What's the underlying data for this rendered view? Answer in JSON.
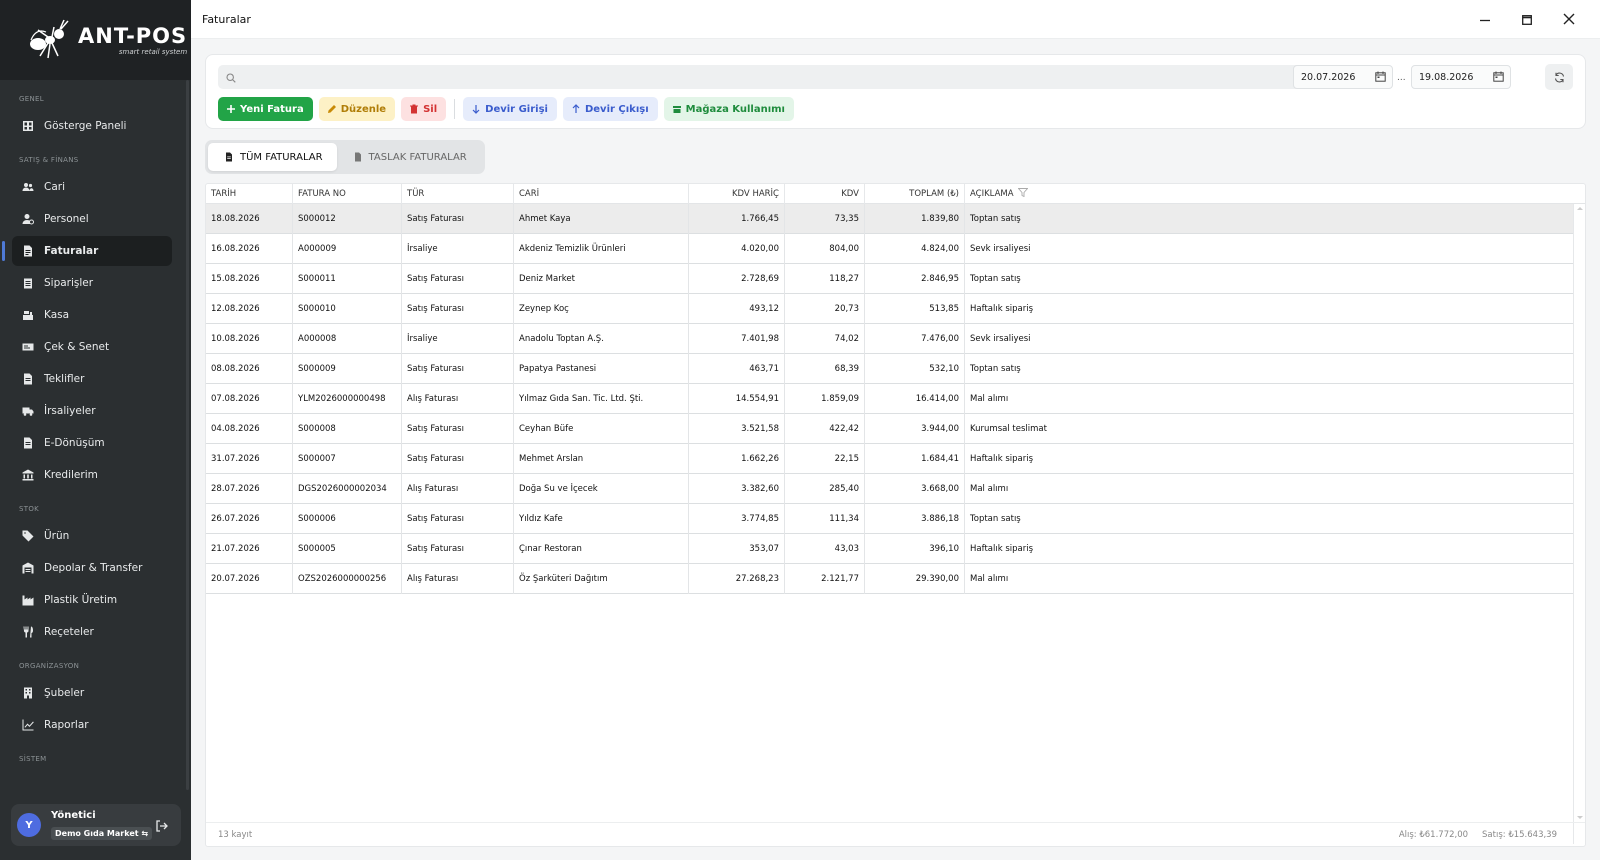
{
  "app": {
    "logo_title": "ANT-POS",
    "logo_subtitle": "smart retail system",
    "window_title": "Faturalar"
  },
  "sidebar": {
    "sections": {
      "genel": "GENEL",
      "satis": "SATIŞ & FİNANS",
      "stok": "STOK",
      "org": "ORGANİZASYON",
      "sistem": "SİSTEM"
    },
    "items": {
      "gosterge": "Gösterge Paneli",
      "cari": "Cari",
      "personel": "Personel",
      "faturalar": "Faturalar",
      "siparisler": "Siparişler",
      "kasa": "Kasa",
      "cek": "Çek & Senet",
      "teklifler": "Teklifler",
      "irsaliyeler": "İrsaliyeler",
      "edonusum": "E-Dönüşüm",
      "kredilerim": "Kredilerim",
      "urun": "Ürün",
      "depolar": "Depolar & Transfer",
      "plastik": "Plastik Üretim",
      "receteler": "Reçeteler",
      "subeler": "Şubeler",
      "raporlar": "Raporlar"
    },
    "active_item": "faturalar",
    "user": {
      "initial": "Y",
      "name": "Yönetici",
      "store": "Demo Gıda Market ⇆"
    }
  },
  "toolbar": {
    "search_placeholder": "",
    "date_from": "20.07.2026",
    "date_separator": "...",
    "date_to": "19.08.2026",
    "buttons": {
      "new": "Yeni Fatura",
      "edit": "Düzenle",
      "delete": "Sil",
      "devir_in": "Devir Girişi",
      "devir_out": "Devir Çıkışı",
      "store_use": "Mağaza Kullanımı"
    }
  },
  "tabs": {
    "all": "TÜM FATURALAR",
    "draft": "TASLAK FATURALAR",
    "active": "all"
  },
  "table": {
    "columns": [
      "TARİH",
      "FATURA NO",
      "TÜR",
      "CARİ",
      "KDV HARİÇ",
      "KDV",
      "TOPLAM (₺)",
      "AÇIKLAMA"
    ],
    "rows": [
      [
        "18.08.2026",
        "S000012",
        "Satış Faturası",
        "Ahmet Kaya",
        "1.766,45",
        "73,35",
        "1.839,80",
        "Toptan satış"
      ],
      [
        "16.08.2026",
        "A000009",
        "İrsaliye",
        "Akdeniz Temizlik Ürünleri",
        "4.020,00",
        "804,00",
        "4.824,00",
        "Sevk irsaliyesi"
      ],
      [
        "15.08.2026",
        "S000011",
        "Satış Faturası",
        "Deniz Market",
        "2.728,69",
        "118,27",
        "2.846,95",
        "Toptan satış"
      ],
      [
        "12.08.2026",
        "S000010",
        "Satış Faturası",
        "Zeynep Koç",
        "493,12",
        "20,73",
        "513,85",
        "Haftalık sipariş"
      ],
      [
        "10.08.2026",
        "A000008",
        "İrsaliye",
        "Anadolu Toptan A.Ş.",
        "7.401,98",
        "74,02",
        "7.476,00",
        "Sevk irsaliyesi"
      ],
      [
        "08.08.2026",
        "S000009",
        "Satış Faturası",
        "Papatya Pastanesi",
        "463,71",
        "68,39",
        "532,10",
        "Toptan satış"
      ],
      [
        "07.08.2026",
        "YLM2026000000498",
        "Alış Faturası",
        "Yılmaz Gıda San. Tic. Ltd. Şti.",
        "14.554,91",
        "1.859,09",
        "16.414,00",
        "Mal alımı"
      ],
      [
        "04.08.2026",
        "S000008",
        "Satış Faturası",
        "Ceyhan Büfe",
        "3.521,58",
        "422,42",
        "3.944,00",
        "Kurumsal teslimat"
      ],
      [
        "31.07.2026",
        "S000007",
        "Satış Faturası",
        "Mehmet Arslan",
        "1.662,26",
        "22,15",
        "1.684,41",
        "Haftalık sipariş"
      ],
      [
        "28.07.2026",
        "DGS2026000002034",
        "Alış Faturası",
        "Doğa Su ve İçecek",
        "3.382,60",
        "285,40",
        "3.668,00",
        "Mal alımı"
      ],
      [
        "26.07.2026",
        "S000006",
        "Satış Faturası",
        "Yıldız Kafe",
        "3.774,85",
        "111,34",
        "3.886,18",
        "Toptan satış"
      ],
      [
        "21.07.2026",
        "S000005",
        "Satış Faturası",
        "Çınar Restoran",
        "353,07",
        "43,03",
        "396,10",
        "Haftalık sipariş"
      ],
      [
        "20.07.2026",
        "OZS2026000000256",
        "Alış Faturası",
        "Öz Şarküteri Dağıtım",
        "27.268,23",
        "2.121,77",
        "29.390,00",
        "Mal alımı"
      ]
    ],
    "selected_row": 0
  },
  "footer": {
    "count": "13 kayıt",
    "purchase": "Alış: ₺61.772,00",
    "sales": "Satış: ₺15.643,39"
  }
}
